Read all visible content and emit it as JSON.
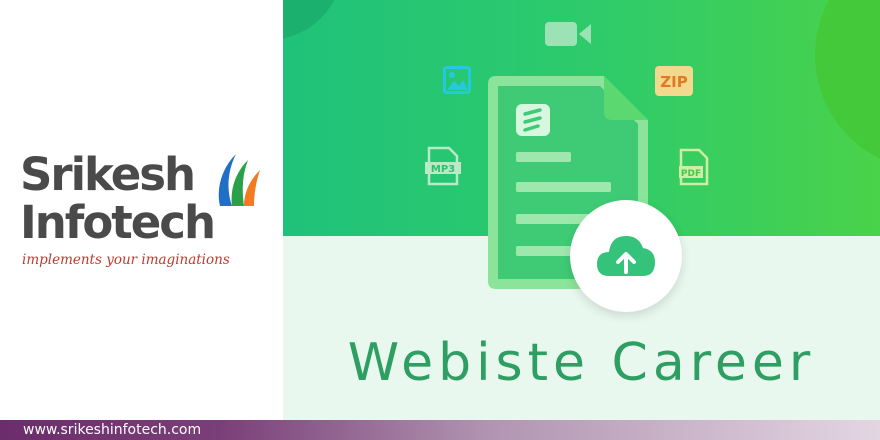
{
  "logo": {
    "line1": "Srikesh",
    "line2": "Infotech",
    "tagline": "implements your imaginations"
  },
  "banner": {
    "title": "Webiste Career",
    "icons": {
      "video": "video-camera-icon",
      "image": "image-icon",
      "zip": "ZIP",
      "mp3": "MP3",
      "pdf": "PDF",
      "upload": "cloud-upload-icon",
      "document": "document-icon"
    }
  },
  "colors": {
    "green_start": "#1fc27a",
    "green_end": "#4ad24a",
    "title_green": "#2e9e63",
    "logo_grey": "#4a4a4a",
    "tagline_red": "#c0392b",
    "footer_purple": "#6b2d6b"
  },
  "footer": {
    "url": "www.srikeshinfotech.com"
  }
}
